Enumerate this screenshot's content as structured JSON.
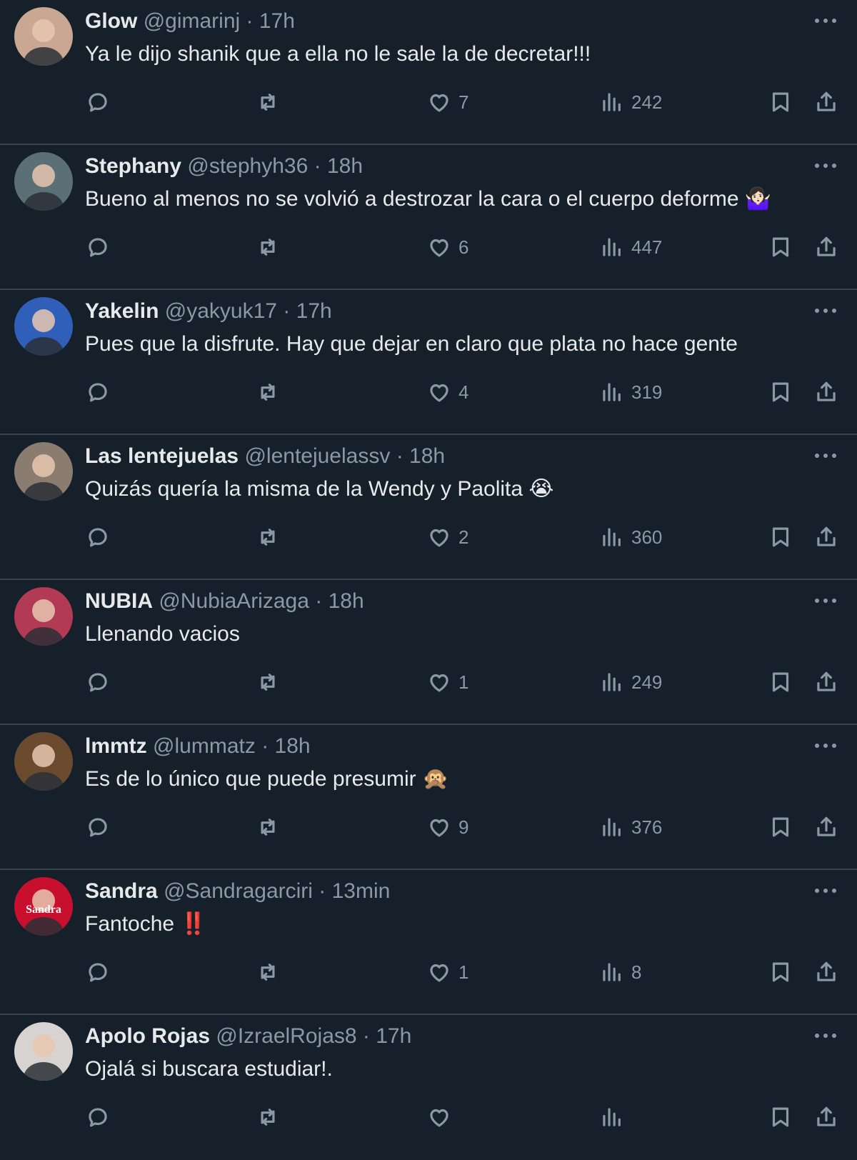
{
  "tweets": [
    {
      "name": "Glow",
      "handle": "@gimarinj",
      "time": "17h",
      "text": "Ya le dijo shanik que a ella no le sale la de decretar!!!",
      "emoji": "",
      "likes": "7",
      "views": "242",
      "avatar_color": "#c9a793"
    },
    {
      "name": "Stephany",
      "handle": "@stephyh36",
      "time": "18h",
      "text": "Bueno al menos no se volvió a destrozar la cara o el cuerpo deforme",
      "emoji": "🤷🏻‍♀️",
      "likes": "6",
      "views": "447",
      "avatar_color": "#5b6f76"
    },
    {
      "name": "Yakelin",
      "handle": "@yakyuk17",
      "time": "17h",
      "text": "Pues que la disfrute. Hay que dejar en claro que plata no hace gente",
      "emoji": "",
      "likes": "4",
      "views": "319",
      "avatar_color": "#2f5fb8"
    },
    {
      "name": "Las lentejuelas",
      "handle": "@lentejuelassv",
      "time": "18h",
      "text": "Quizás quería la misma de la Wendy y Paolita",
      "emoji": "😭",
      "likes": "2",
      "views": "360",
      "avatar_color": "#8a7c6e"
    },
    {
      "name": "NUBIA",
      "handle": "@NubiaArizaga",
      "time": "18h",
      "text": "Llenando vacios",
      "emoji": "",
      "likes": "1",
      "views": "249",
      "avatar_color": "#b23a54"
    },
    {
      "name": "lmmtz",
      "handle": "@lummatz",
      "time": "18h",
      "text": "Es de lo único que puede presumir",
      "emoji": "🙊",
      "likes": "9",
      "views": "376",
      "avatar_color": "#6b4a2e"
    },
    {
      "name": "Sandra",
      "handle": "@Sandragarciri",
      "time": "13min",
      "text": "Fantoche ‼️",
      "emoji": "",
      "likes": "1",
      "views": "8",
      "avatar_color": "#c8102e",
      "avatar_text": "Sandra"
    },
    {
      "name": "Apolo Rojas",
      "handle": "@IzraelRojas8",
      "time": "17h",
      "text": "Ojalá si buscara estudiar!.",
      "emoji": "",
      "likes": "",
      "views": "",
      "avatar_color": "#d7d3d0"
    }
  ],
  "separator": "·",
  "colors": {
    "background": "#15202b",
    "divider": "#38444d",
    "text_primary": "#e7e9ea",
    "text_secondary": "#8b98a5"
  },
  "icons": [
    "reply-icon",
    "retweet-icon",
    "like-icon",
    "views-icon",
    "bookmark-icon",
    "share-icon",
    "more-icon"
  ]
}
